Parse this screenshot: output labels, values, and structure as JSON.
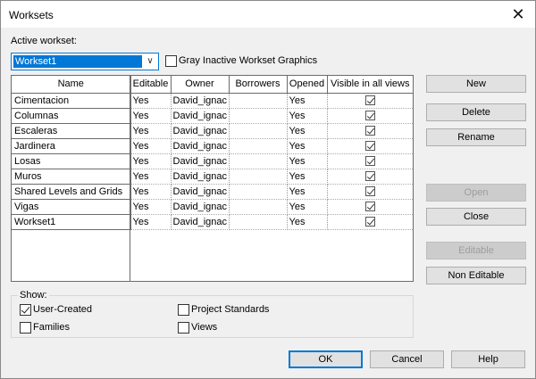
{
  "window": {
    "title": "Worksets",
    "close_glyph": "✕"
  },
  "active": {
    "label": "Active workset:",
    "value": "Workset1",
    "gray_inactive_label": "Gray Inactive Workset Graphics",
    "gray_inactive_checked": false
  },
  "table": {
    "columns": [
      "Name",
      "Editable",
      "Owner",
      "Borrowers",
      "Opened",
      "Visible in all views"
    ],
    "rows": [
      {
        "name": "Cimentacion",
        "editable": "Yes",
        "owner": "David_ignac",
        "borrowers": "",
        "opened": "Yes",
        "visible": true
      },
      {
        "name": "Columnas",
        "editable": "Yes",
        "owner": "David_ignac",
        "borrowers": "",
        "opened": "Yes",
        "visible": true
      },
      {
        "name": "Escaleras",
        "editable": "Yes",
        "owner": "David_ignac",
        "borrowers": "",
        "opened": "Yes",
        "visible": true
      },
      {
        "name": "Jardinera",
        "editable": "Yes",
        "owner": "David_ignac",
        "borrowers": "",
        "opened": "Yes",
        "visible": true
      },
      {
        "name": "Losas",
        "editable": "Yes",
        "owner": "David_ignac",
        "borrowers": "",
        "opened": "Yes",
        "visible": true
      },
      {
        "name": "Muros",
        "editable": "Yes",
        "owner": "David_ignac",
        "borrowers": "",
        "opened": "Yes",
        "visible": true
      },
      {
        "name": "Shared Levels and Grids",
        "editable": "Yes",
        "owner": "David_ignac",
        "borrowers": "",
        "opened": "Yes",
        "visible": true
      },
      {
        "name": "Vigas",
        "editable": "Yes",
        "owner": "David_ignac",
        "borrowers": "",
        "opened": "Yes",
        "visible": true
      },
      {
        "name": "Workset1",
        "editable": "Yes",
        "owner": "David_ignac",
        "borrowers": "",
        "opened": "Yes",
        "visible": true
      }
    ]
  },
  "side_buttons": {
    "new": "New",
    "delete": "Delete",
    "rename": "Rename",
    "open": "Open",
    "close": "Close",
    "editable": "Editable",
    "non_editable": "Non Editable"
  },
  "show": {
    "label": "Show:",
    "user_created": "User-Created",
    "user_created_checked": true,
    "families": "Families",
    "families_checked": false,
    "project_standards": "Project Standards",
    "project_standards_checked": false,
    "views": "Views",
    "views_checked": false
  },
  "footer": {
    "ok": "OK",
    "cancel": "Cancel",
    "help": "Help"
  },
  "colors": {
    "accent": "#0078d7",
    "disabled_text": "#9e9e9e"
  }
}
